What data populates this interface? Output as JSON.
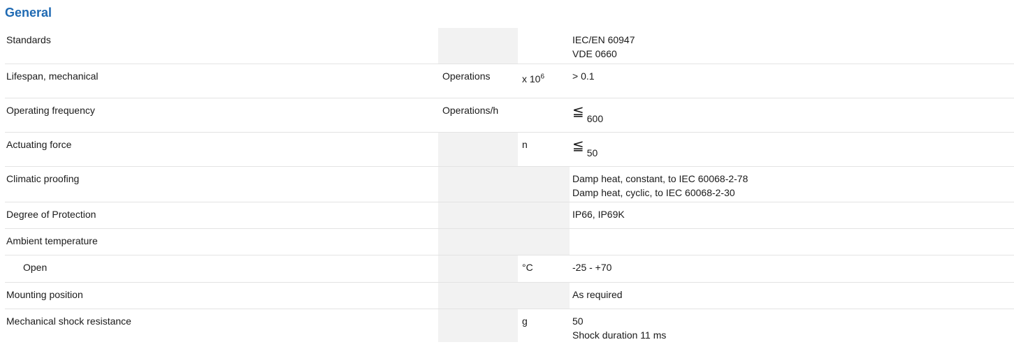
{
  "section": {
    "title": "General"
  },
  "rows": [
    {
      "label": "Standards",
      "unit": "",
      "factor": "",
      "value_lines": [
        "IEC/EN 60947",
        "VDE 0660"
      ]
    },
    {
      "label": "Lifespan, mechanical",
      "unit": "Operations",
      "factor_base": "x 10",
      "factor_exp": "6",
      "value": "> 0.1"
    },
    {
      "label": "Operating frequency",
      "unit": "Operations/h",
      "factor": "",
      "value_symbol": "≦",
      "value": "600"
    },
    {
      "label": "Actuating force",
      "unit": "",
      "factor": "n",
      "value_symbol": "≦",
      "value": "50"
    },
    {
      "label": "Climatic proofing",
      "unit": "",
      "factor": "",
      "value_lines": [
        "Damp heat, constant, to IEC 60068-2-78",
        "Damp heat, cyclic, to IEC 60068-2-30"
      ]
    },
    {
      "label": "Degree of Protection",
      "unit": "",
      "factor": "",
      "value": "IP66, IP69K"
    },
    {
      "label": "Ambient temperature",
      "unit": "",
      "factor": "",
      "value": ""
    },
    {
      "label": "Open",
      "unit": "",
      "factor": "°C",
      "value": "-25 - +70"
    },
    {
      "label": "Mounting position",
      "unit": "",
      "factor": "",
      "value": "As required"
    },
    {
      "label": "Mechanical shock resistance",
      "unit": "",
      "factor": "g",
      "value_lines": [
        "50",
        "Shock duration 11 ms"
      ]
    }
  ]
}
